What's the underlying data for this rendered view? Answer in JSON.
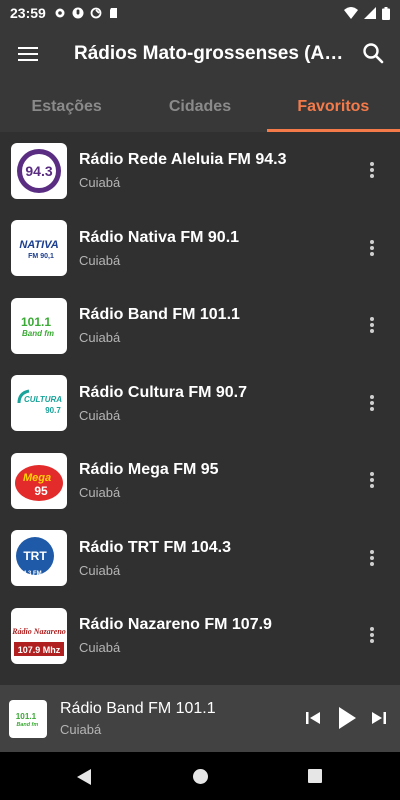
{
  "status_bar": {
    "time": "23:59"
  },
  "app_bar": {
    "title": "Rádios Mato-grossenses (A…",
    "menu_icon": "hamburger-menu-icon",
    "search_icon": "search-icon"
  },
  "tabs": [
    {
      "label": "Estações",
      "active": false
    },
    {
      "label": "Cidades",
      "active": false
    },
    {
      "label": "Favoritos",
      "active": true
    }
  ],
  "stations": [
    {
      "name": "Rádio Rede Aleluia FM 94.3",
      "city": "Cuiabá",
      "logo_text": "94.3",
      "logo_color": "#5a2d82"
    },
    {
      "name": "Rádio Nativa FM 90.1",
      "city": "Cuiabá",
      "logo_text": "NATIVA",
      "logo_sub": "FM 90,1",
      "logo_color": "#1b3e8f"
    },
    {
      "name": "Rádio Band FM 101.1",
      "city": "Cuiabá",
      "logo_text": "101.1",
      "logo_sub": "Band fm",
      "logo_color": "#3ba935"
    },
    {
      "name": "Rádio Cultura FM 90.7",
      "city": "Cuiabá",
      "logo_text": "CULTURA",
      "logo_sub": "90.7",
      "logo_color": "#1aa39a"
    },
    {
      "name": "Rádio Mega FM 95",
      "city": "Cuiabá",
      "logo_text": "Mega",
      "logo_sub": "95",
      "logo_color": "#e32b2b"
    },
    {
      "name": "Rádio TRT FM 104.3",
      "city": "Cuiabá",
      "logo_text": "TRT",
      "logo_sub": "104,3 FM",
      "logo_color": "#1f5aa8"
    },
    {
      "name": "Rádio Nazareno FM 107.9",
      "city": "Cuiabá",
      "logo_text": "Rádio Nazareno",
      "logo_sub": "107.9 Mhz",
      "logo_color": "#b02020"
    }
  ],
  "player": {
    "name": "Rádio Band FM 101.1",
    "city": "Cuiabá",
    "logo_text": "101.1",
    "logo_sub": "Band fm"
  },
  "colors": {
    "accent": "#f47a4a",
    "background": "#303030",
    "bar": "#383838",
    "player": "#424242"
  }
}
